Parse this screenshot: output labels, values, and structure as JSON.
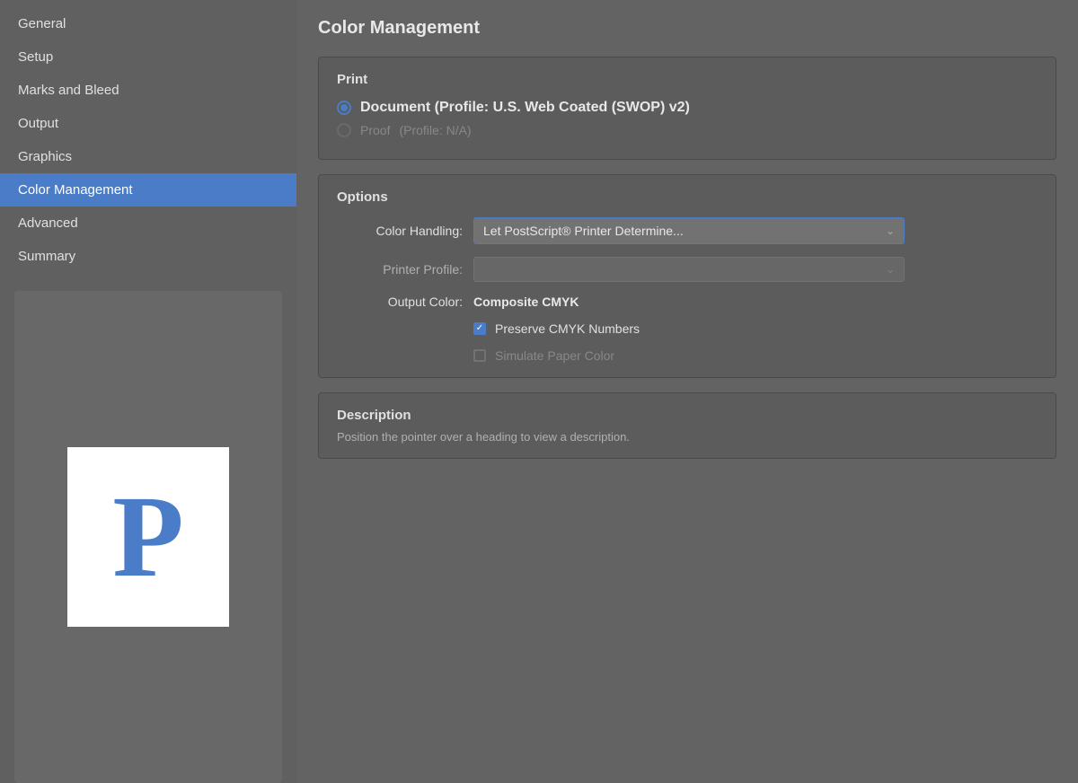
{
  "sidebar": {
    "items": [
      {
        "id": "general",
        "label": "General",
        "active": false
      },
      {
        "id": "setup",
        "label": "Setup",
        "active": false
      },
      {
        "id": "marks-and-bleed",
        "label": "Marks and Bleed",
        "active": false
      },
      {
        "id": "output",
        "label": "Output",
        "active": false
      },
      {
        "id": "graphics",
        "label": "Graphics",
        "active": false
      },
      {
        "id": "color-management",
        "label": "Color Management",
        "active": true
      },
      {
        "id": "advanced",
        "label": "Advanced",
        "active": false
      },
      {
        "id": "summary",
        "label": "Summary",
        "active": false
      }
    ],
    "preview_letter": "P"
  },
  "main": {
    "title": "Color Management",
    "print_section": {
      "title": "Print",
      "radio_document_label": "Document (Profile: U.S. Web Coated (SWOP) v2)",
      "radio_document_selected": true,
      "radio_proof_label": "Proof",
      "radio_proof_profile": "(Profile: N/A)",
      "radio_proof_disabled": true
    },
    "options_section": {
      "title": "Options",
      "color_handling_label": "Color Handling:",
      "color_handling_value": "Let PostScript® Printer Determine...",
      "printer_profile_label": "Printer Profile:",
      "printer_profile_value": "",
      "output_color_label": "Output Color:",
      "output_color_value": "Composite CMYK",
      "preserve_cmyk_label": "Preserve CMYK Numbers",
      "preserve_cmyk_checked": true,
      "simulate_paper_label": "Simulate Paper Color",
      "simulate_paper_checked": false,
      "simulate_paper_disabled": true
    },
    "description_section": {
      "title": "Description",
      "text": "Position the pointer over a heading to view a description."
    }
  }
}
